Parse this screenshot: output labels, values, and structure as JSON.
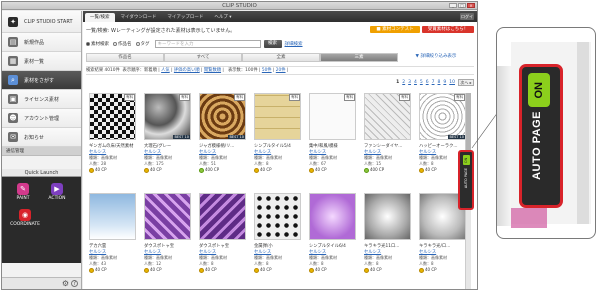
{
  "window": {
    "title": "CLIP STUDIO",
    "btn_min": "_",
    "btn_max": "□",
    "btn_close": "×"
  },
  "sidebar": {
    "items": [
      {
        "label": "CLIP STUDIO START",
        "icon": "clip-studio-icon",
        "color": "#2b2b2b"
      },
      {
        "label": "新規作品",
        "icon": "new-work-icon",
        "color": "#6d6d6d"
      },
      {
        "label": "素材一覧",
        "icon": "material-list-icon",
        "color": "#6d6d6d"
      },
      {
        "label": "素材をさがす",
        "icon": "search-icon",
        "color": "#5c8fd6"
      },
      {
        "label": "ライセンス素材",
        "icon": "license-icon",
        "color": "#6d6d6d"
      },
      {
        "label": "アカウント管理",
        "icon": "account-icon",
        "color": "#6d6d6d"
      },
      {
        "label": "お知らせ",
        "icon": "notice-icon",
        "color": "#6d6d6d"
      }
    ],
    "section": "通信管理",
    "quick_launch": "Quick Launch",
    "launchers": [
      {
        "label": "PAINT",
        "color": "#d23a8c",
        "glyph": "✎"
      },
      {
        "label": "ACTION",
        "color": "#7d3fbf",
        "glyph": "▶"
      },
      {
        "label": "COORDINATE",
        "color": "#d8232a",
        "glyph": "◉"
      }
    ],
    "bottom_icons": [
      "gear-icon",
      "help-icon"
    ],
    "gear_glyph": "⚙",
    "help_glyph": "?"
  },
  "main": {
    "tabs": [
      "一覧/検索",
      "マイダウンロード",
      "マイアップロード",
      "ヘルプ ▾"
    ],
    "logout": "ログイン",
    "notice": "一覧/検索: Wレーティングが設定された素材は表示していません。",
    "banner1": "■ 素材コンテスト",
    "banner2": "受賞素材はこちら！",
    "search": {
      "radios": [
        "素材検索",
        "作品名",
        "タグ"
      ],
      "placeholder": "キーワードを入力",
      "button": "検索",
      "detail": "詳細検索"
    },
    "categories": [
      "作品名",
      "すべて",
      "全素",
      "三素",
      "▼ 詳細絞り込み表示"
    ],
    "filter": {
      "prefix": "検索結果 4010件",
      "sort_label": "表示順序：新着順 |",
      "sort_links": [
        "人気",
        "評価の高い順",
        "閲覧数順"
      ],
      "per_label": "表示数：100件 |",
      "per_links": [
        "50件",
        "20件"
      ]
    },
    "pages": [
      "1",
      "2",
      "3",
      "4",
      "5",
      "6",
      "7",
      "8",
      "9",
      "10"
    ],
    "next": "次へ ▸",
    "cards": [
      {
        "title": "ギンガムの床/天然素材",
        "author": "セルシス",
        "type": "種類：画像素材",
        "count": "人数：28",
        "price": "40 CP",
        "coin": "gold",
        "badge": "有料",
        "best": "",
        "pattern": "checker"
      },
      {
        "title": "大理石/グレー",
        "author": "セルシス",
        "type": "種類：画像素材",
        "count": "人数：175",
        "price": "40 CP",
        "coin": "gold",
        "badge": "有料",
        "best": "BEST 10",
        "pattern": "marble"
      },
      {
        "title": "ジャガ模様柄/リ...",
        "author": "セルシス",
        "type": "種類：画像素材",
        "count": "人数：51",
        "price": "400 CP",
        "coin": "green",
        "badge": "有料",
        "best": "BEST 10",
        "pattern": "ornate"
      },
      {
        "title": "シンプルタイル5/4",
        "author": "セルシス",
        "type": "種類：画像素材",
        "count": "人数：8",
        "price": "40 CP",
        "coin": "gold",
        "badge": "有料",
        "best": "",
        "pattern": "tile"
      },
      {
        "title": "集中/和風/模様",
        "author": "セルシス",
        "type": "種類：画像素材",
        "count": "人数：67",
        "price": "40 CP",
        "coin": "gold",
        "badge": "有料",
        "best": "",
        "pattern": "plain"
      },
      {
        "title": "ファンシーダイヤ...",
        "author": "セルシス",
        "type": "種類：画像素材",
        "count": "人数：15",
        "price": "400 CP",
        "coin": "green",
        "badge": "有料",
        "best": "",
        "pattern": "diamond"
      },
      {
        "title": "ハッピーオーラク...",
        "author": "セルシス",
        "type": "種類：画像素材",
        "count": "人数：8",
        "price": "40 CP",
        "coin": "gold",
        "badge": "有料",
        "best": "BEST 10",
        "pattern": "lace"
      },
      {
        "title": "デカ六雲",
        "author": "セルシス",
        "type": "種類：画像素材",
        "count": "人数：43",
        "price": "40 CP",
        "coin": "gold",
        "badge": "",
        "best": "",
        "pattern": "sky"
      },
      {
        "title": "ダウスポトャ宝",
        "author": "セルシス",
        "type": "種類：画像素材",
        "count": "人数：12",
        "price": "40 CP",
        "coin": "gold",
        "badge": "",
        "best": "",
        "pattern": "purple"
      },
      {
        "title": "ダウスポトャ宝",
        "author": "セルシス",
        "type": "種類：画像素材",
        "count": "人数：8",
        "price": "40 CP",
        "coin": "gold",
        "badge": "",
        "best": "",
        "pattern": "purple2"
      },
      {
        "title": "金属弾/小",
        "author": "セルシス",
        "type": "種類：画像素材",
        "count": "人数：8",
        "price": "40 CP",
        "coin": "gold",
        "badge": "",
        "best": "",
        "pattern": "dots"
      },
      {
        "title": "シンプルタイル6/4",
        "author": "セルシス",
        "type": "種類：画像素材",
        "count": "人数：8",
        "price": "40 CP",
        "coin": "gold",
        "badge": "",
        "best": "",
        "pattern": "violet"
      },
      {
        "title": "キラキラ光11ロ...",
        "author": "セルシス",
        "type": "種類：画像素材",
        "count": "人数：8",
        "price": "40 CP",
        "coin": "gold",
        "badge": "",
        "best": "",
        "pattern": "sparkle"
      },
      {
        "title": "キラキラ光/ロ...",
        "author": "セルシス",
        "type": "種類：画像素材",
        "count": "人数：8",
        "price": "40 CP",
        "coin": "gold",
        "badge": "",
        "best": "",
        "pattern": "sparkle2"
      }
    ]
  },
  "autopage": {
    "on": "ON",
    "label": "AUTO PAGE"
  },
  "colors": {
    "accent_red": "#d8232a",
    "on_green": "#8ccf1c",
    "link_blue": "#2a66b8"
  }
}
